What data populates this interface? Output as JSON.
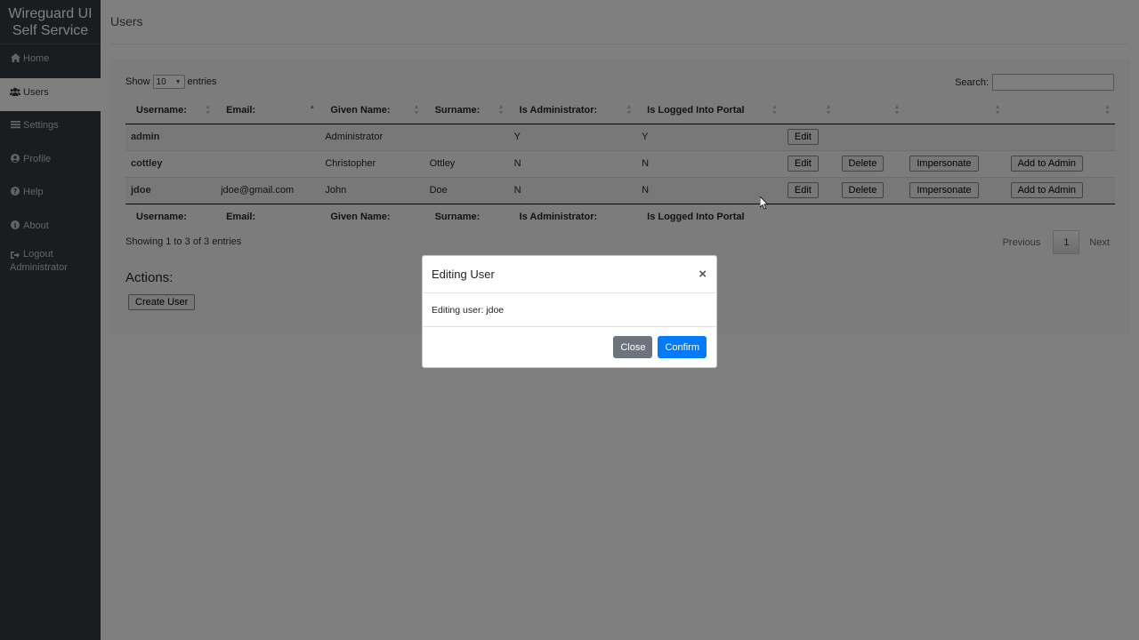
{
  "sidebar": {
    "brand_line1": "Wireguard UI",
    "brand_line2": "Self Service",
    "items": [
      {
        "label": "Home",
        "icon": "home-icon"
      },
      {
        "label": "Users",
        "icon": "users-icon"
      },
      {
        "label": "Settings",
        "icon": "list-icon"
      },
      {
        "label": "Profile",
        "icon": "user-circle-icon"
      },
      {
        "label": "Help",
        "icon": "question-circle-icon"
      },
      {
        "label": "About",
        "icon": "info-circle-icon"
      }
    ],
    "logout_line1": "Logout",
    "logout_line2": "Administrator"
  },
  "page": {
    "title": "Users"
  },
  "table_controls": {
    "show_label": "Show",
    "entries_value": "10",
    "entries_label": "entries",
    "search_label": "Search:",
    "search_value": ""
  },
  "table": {
    "columns": [
      "Username:",
      "Email:",
      "Given Name:",
      "Surname:",
      "Is Administrator:",
      "Is Logged Into Portal"
    ],
    "rows": [
      {
        "username": "admin",
        "email": "",
        "given": "Administrator",
        "surname": "",
        "is_admin": "Y",
        "logged_in": "Y"
      },
      {
        "username": "cottley",
        "email": "",
        "given": "Christopher",
        "surname": "Ottley",
        "is_admin": "N",
        "logged_in": "N"
      },
      {
        "username": "jdoe",
        "email": "jdoe@gmail.com",
        "given": "John",
        "surname": "Doe",
        "is_admin": "N",
        "logged_in": "N"
      }
    ],
    "edit_label": "Edit",
    "delete_label": "Delete",
    "impersonate_label": "Impersonate",
    "add_admin_label": "Add to Admin",
    "info": "Showing 1 to 3 of 3 entries",
    "prev_label": "Previous",
    "current_page": "1",
    "next_label": "Next"
  },
  "actions": {
    "title": "Actions:",
    "create_label": "Create User"
  },
  "modal": {
    "title": "Editing User",
    "close_glyph": "×",
    "body": "Editing user: jdoe",
    "close_label": "Close",
    "confirm_label": "Confirm"
  },
  "colors": {
    "sidebar_bg": "#343a40",
    "primary": "#007bff",
    "secondary": "#6c757d"
  }
}
